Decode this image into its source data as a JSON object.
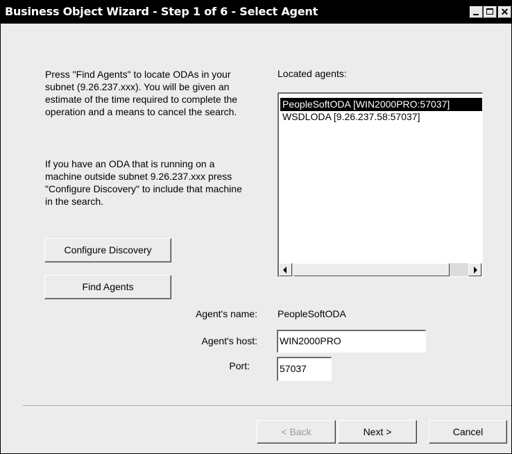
{
  "window": {
    "title": "Business Object Wizard - Step 1 of 6 - Select Agent"
  },
  "description": {
    "paragraph1": "Press \"Find Agents\" to locate ODAs in your subnet (9.26.237.xxx). You will be given an estimate of the time required to complete the operation and a means to cancel the search.",
    "paragraph2": "If you have an ODA that is running on a machine outside subnet 9.26.237.xxx press \"Configure Discovery\" to include that machine in the search."
  },
  "buttons": {
    "configure_discovery": "Configure Discovery",
    "find_agents": "Find Agents",
    "back": "< Back",
    "next": "Next >",
    "cancel": "Cancel"
  },
  "located_agents": {
    "label": "Located agents:",
    "items": [
      {
        "label": "PeopleSoftODA [WIN2000PRO:57037]",
        "selected": true
      },
      {
        "label": "WSDLODA [9.26.237.58:57037]",
        "selected": false
      }
    ]
  },
  "fields": {
    "agent_name_label": "Agent's name:",
    "agent_name_value": "PeopleSoftODA",
    "agent_host_label": "Agent's host:",
    "agent_host_value": "WIN2000PRO",
    "port_label": "Port:",
    "port_value": "57037"
  },
  "colors": {
    "titlebar": "#000000",
    "dialog_background": "#ececec",
    "selection": "#000000"
  }
}
